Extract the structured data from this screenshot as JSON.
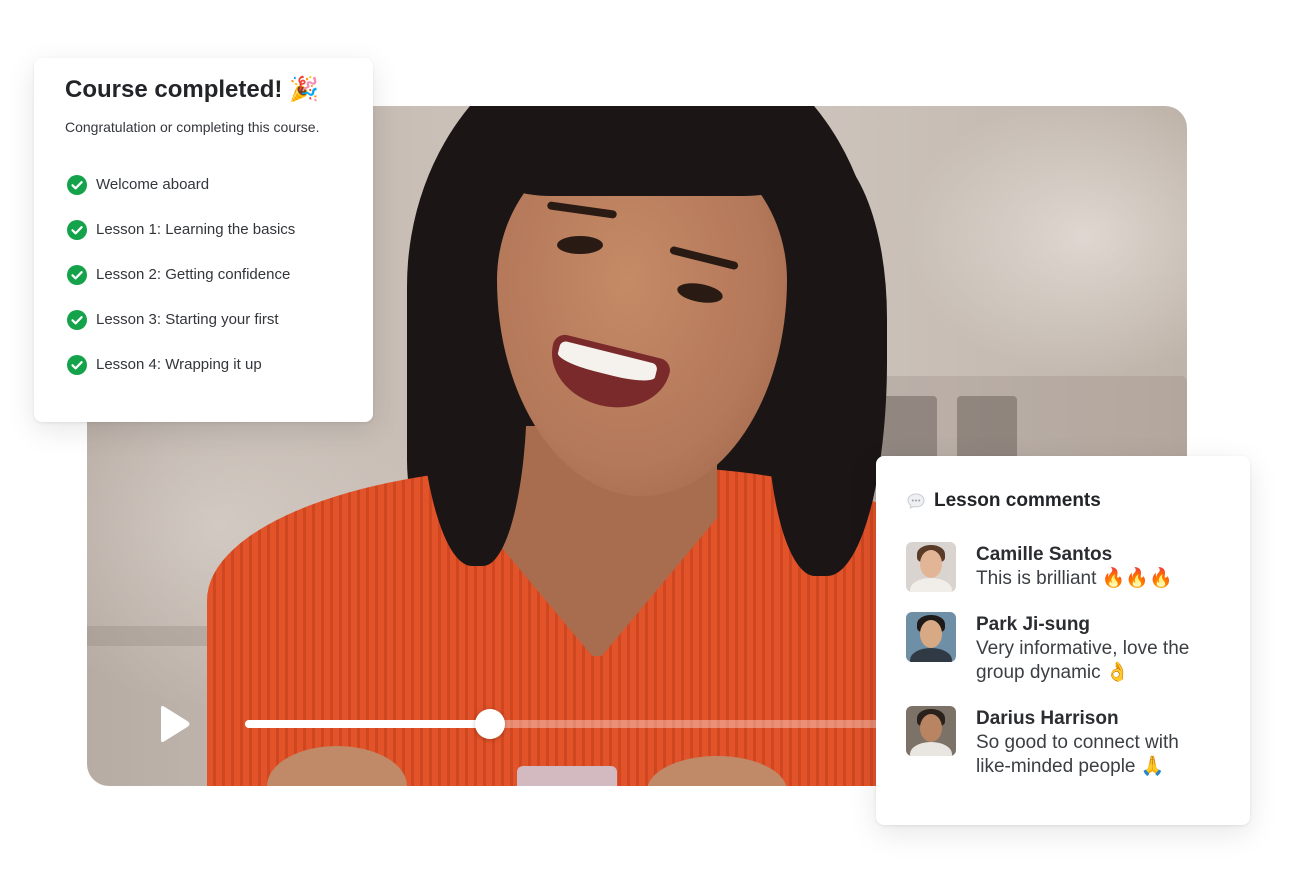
{
  "course_card": {
    "title": "Course completed! 🎉",
    "subtitle": "Congratulation or completing this course.",
    "lessons": [
      {
        "label": "Welcome aboard",
        "completed": true
      },
      {
        "label": "Lesson 1: Learning the basics",
        "completed": true
      },
      {
        "label": "Lesson 2: Getting confidence",
        "completed": true
      },
      {
        "label": "Lesson 3: Starting your first",
        "completed": true
      },
      {
        "label": "Lesson 4: Wrapping it up",
        "completed": true
      }
    ],
    "icon": "check-circle-icon",
    "check_color": "#14a34a"
  },
  "video": {
    "progress_percent": 26,
    "play_icon": "play-icon"
  },
  "comments_card": {
    "title": "Lesson comments",
    "icon": "speech-bubble-icon",
    "comments": [
      {
        "name": "Camille Santos",
        "text": "This is brilliant 🔥🔥🔥"
      },
      {
        "name": "Park Ji-sung",
        "text": "Very informative, love the group dynamic  👌"
      },
      {
        "name": "Darius Harrison",
        "text": "So good to connect with like-minded people 🙏"
      }
    ]
  }
}
